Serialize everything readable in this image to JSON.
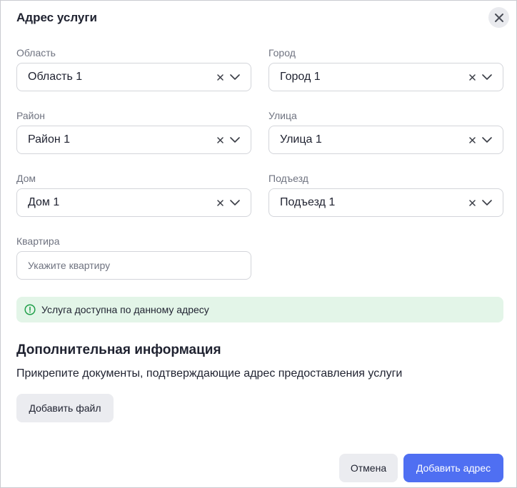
{
  "dialog": {
    "title": "Адрес услуги"
  },
  "fields": {
    "region": {
      "label": "Область",
      "value": "Область 1"
    },
    "city": {
      "label": "Город",
      "value": "Город 1"
    },
    "district": {
      "label": "Район",
      "value": "Район 1"
    },
    "street": {
      "label": "Улица",
      "value": "Улица 1"
    },
    "house": {
      "label": "Дом",
      "value": "Дом 1"
    },
    "entrance": {
      "label": "Подъезд",
      "value": "Подъезд 1"
    },
    "apartment": {
      "label": "Квартира",
      "value": "",
      "placeholder": "Укажите квартиру"
    }
  },
  "notice": {
    "text": "Услуга доступна по данному адресу",
    "icon": "info-circle-icon",
    "color": "#22a04b"
  },
  "additional": {
    "title": "Дополнительная информация",
    "description": "Прикрепите документы, подтверждающие адрес предоставления услуги",
    "add_file_label": "Добавить файл"
  },
  "footer": {
    "cancel_label": "Отмена",
    "submit_label": "Добавить адрес"
  },
  "colors": {
    "primary": "#4f6ff2",
    "success_bg": "#e3f5e8"
  }
}
